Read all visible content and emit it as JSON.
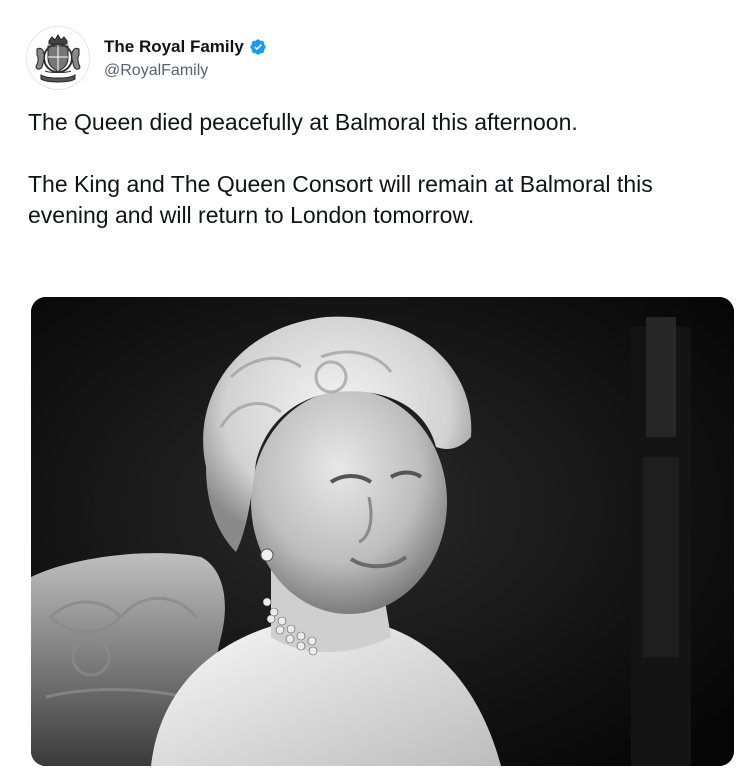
{
  "tweet": {
    "author": {
      "display_name": "The Royal Family",
      "handle": "@RoyalFamily",
      "verified": true,
      "verified_color": "#1d9bf0",
      "avatar_icon": "royal-coat-of-arms-icon"
    },
    "paragraphs": [
      "The Queen died peacefully at Balmoral this afternoon.",
      "The King and The Queen Consort will remain at Balmoral this evening and will return to London tomorrow."
    ],
    "media": {
      "kind": "photo",
      "style": "black-and-white portrait"
    }
  }
}
